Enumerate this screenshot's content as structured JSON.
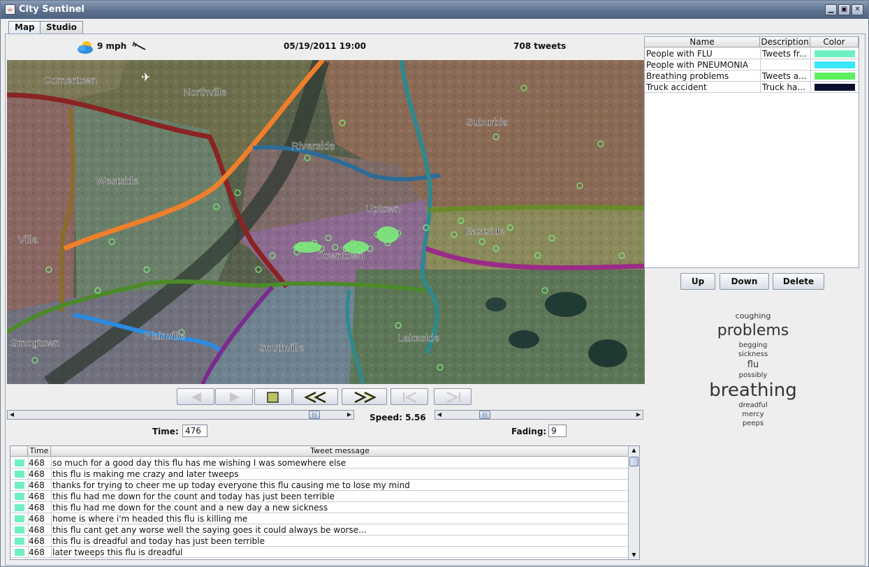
{
  "window": {
    "title": "City Sentinel",
    "controls": [
      "minimize",
      "maximize",
      "close"
    ]
  },
  "tabs": [
    {
      "label": "Map",
      "active": true
    },
    {
      "label": "Studio",
      "active": false
    }
  ],
  "status": {
    "wind": "9 mph",
    "datetime": "05/19/2011 19:00",
    "tweet_count": "708 tweets"
  },
  "map": {
    "districts": [
      "Cornertown",
      "Northville",
      "Suburbia",
      "Riverside",
      "Westside",
      "Uptown",
      "Eastside",
      "Villa",
      "Downtown",
      "Plainville",
      "Smogtown",
      "Southville",
      "Lakeside"
    ]
  },
  "playback": {
    "buttons": [
      "play-backward",
      "play-forward",
      "stop",
      "rewind",
      "fast-forward",
      "skip-start",
      "skip-end"
    ]
  },
  "time": {
    "label": "Time:",
    "value": "476",
    "slider_fraction": 0.92
  },
  "speed": {
    "label": "Speed: 5.56",
    "slider_fraction": 0.2
  },
  "fading": {
    "label": "Fading:",
    "value": "9"
  },
  "tweets": {
    "headers": [
      "",
      "Time",
      "Tweet message"
    ],
    "rows": [
      {
        "time": "468",
        "message": "so much for a good day this flu has me wishing I was somewhere else",
        "color": "#6ef0c0"
      },
      {
        "time": "468",
        "message": "this flu is making me crazy and later tweeps",
        "color": "#6ef0c0"
      },
      {
        "time": "468",
        "message": "thanks for trying to cheer me up today everyone this flu causing me to lose my mind",
        "color": "#6ef0c0"
      },
      {
        "time": "468",
        "message": "this flu had me down for the count and today has just been terrible",
        "color": "#6ef0c0"
      },
      {
        "time": "468",
        "message": "this flu had me down for the count and a new day a new sickness",
        "color": "#6ef0c0"
      },
      {
        "time": "468",
        "message": "home is where i'm headed this flu is killing me",
        "color": "#6ef0c0"
      },
      {
        "time": "468",
        "message": "this flu cant get any worse well the saying goes it could always be worse...",
        "color": "#6ef0c0"
      },
      {
        "time": "468",
        "message": "this flu is dreadful and today has just been terrible",
        "color": "#6ef0c0"
      },
      {
        "time": "468",
        "message": "later tweeps this flu is dreadful",
        "color": "#6ef0c0"
      }
    ]
  },
  "layers": {
    "headers": [
      "Name",
      "Description",
      "Color"
    ],
    "rows": [
      {
        "name": "People with FLU",
        "description": "Tweets fr...",
        "color": "#6ef0c0"
      },
      {
        "name": "People with PNEUMONIA",
        "description": "",
        "color": "#38e8f8"
      },
      {
        "name": "Breathing problems",
        "description": "Tweets a...",
        "color": "#5cf060"
      },
      {
        "name": "Truck accident",
        "description": "Truck ha...",
        "color": "#0a0f30"
      }
    ],
    "buttons": {
      "up": "Up",
      "down": "Down",
      "delete": "Delete"
    }
  },
  "word_cloud": [
    "coughing",
    "problems",
    "begging",
    "sickness",
    "flu",
    "possibly",
    "breathing",
    "dreadful",
    "mercy",
    "peeps"
  ]
}
